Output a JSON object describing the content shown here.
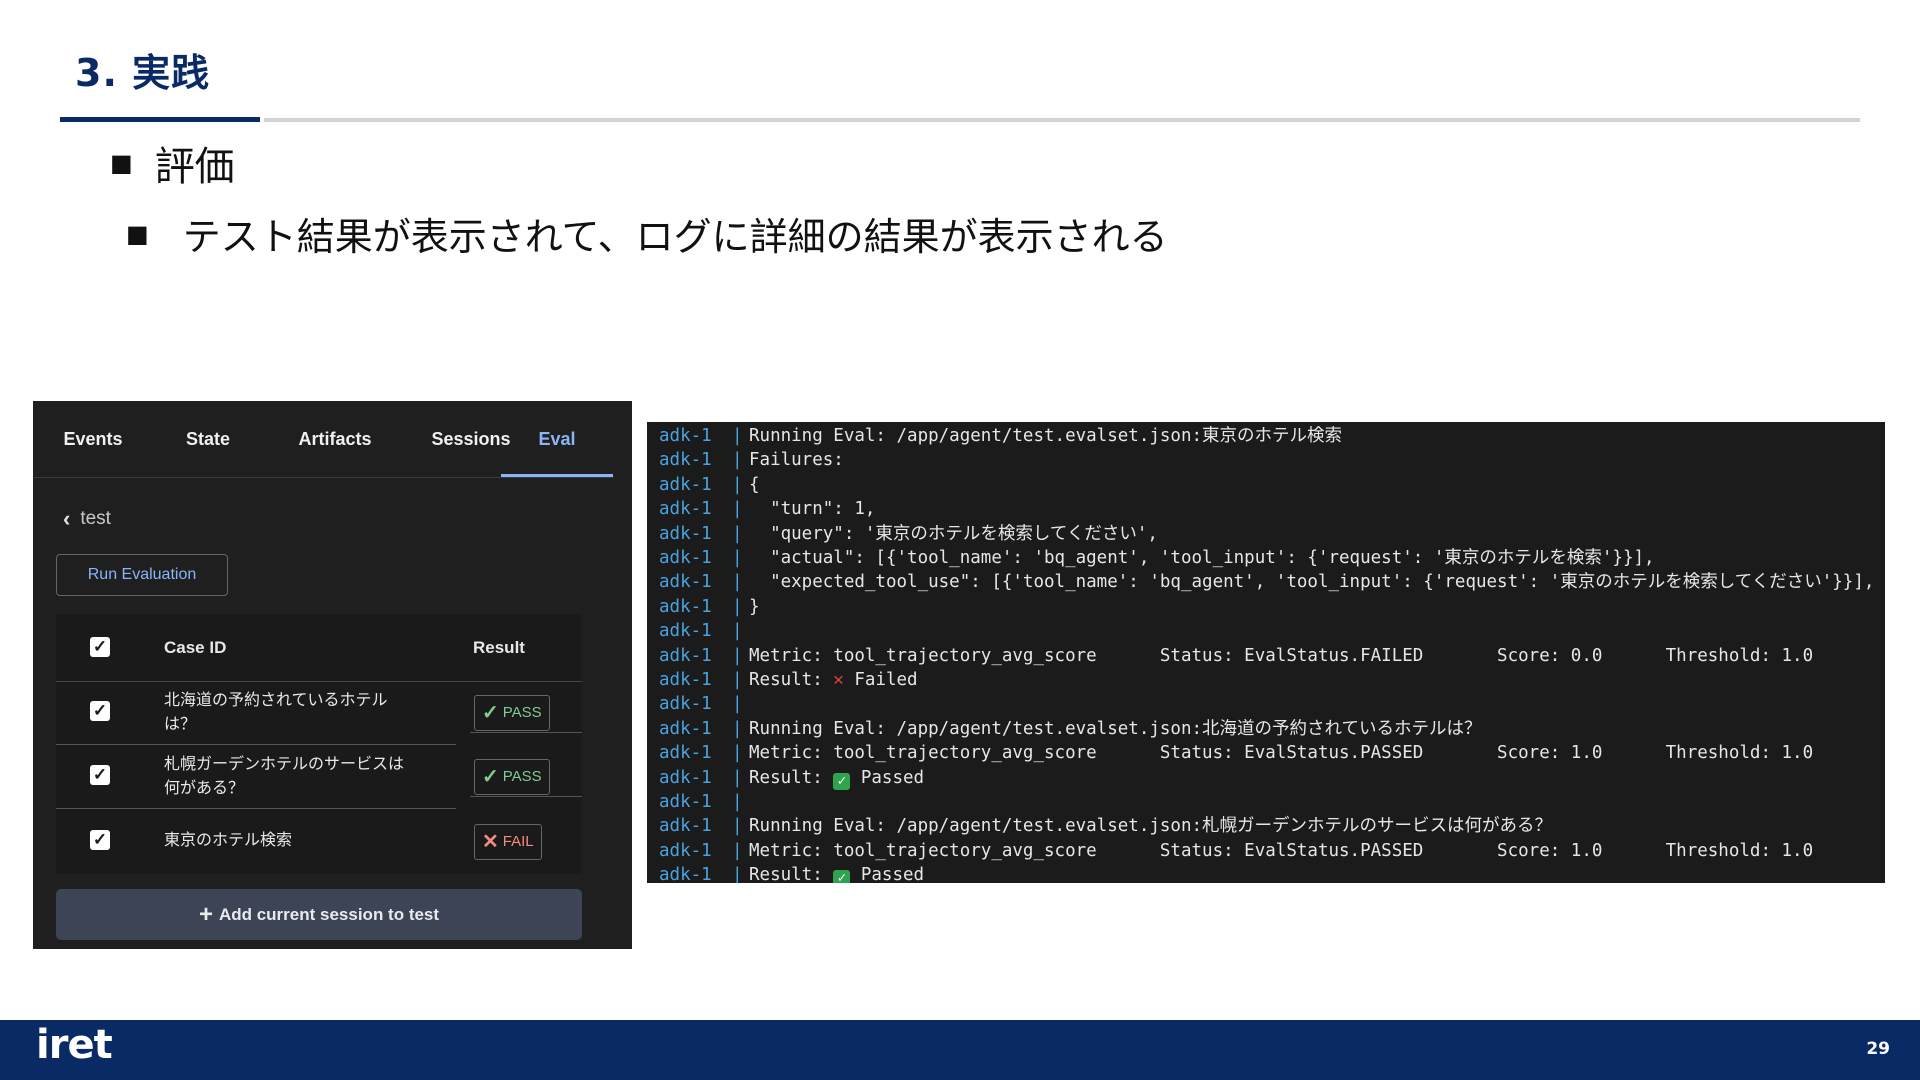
{
  "slide": {
    "title": "3. 実践",
    "bullet_mark": "■",
    "bullet1": "評価",
    "bullet2": "テスト結果が表示されて、ログに詳細の結果が表示される",
    "page_number": "29",
    "logo_text": "iret"
  },
  "eval_panel": {
    "tabs": [
      "Events",
      "State",
      "Artifacts",
      "Sessions",
      "Eval"
    ],
    "active_tab": "Eval",
    "back_label": "test",
    "run_button": "Run Evaluation",
    "table": {
      "header_case": "Case ID",
      "header_result": "Result",
      "rows": [
        {
          "case": "北海道の予約されているホテルは？",
          "result": "PASS"
        },
        {
          "case": "札幌ガーデンホテルのサービスは何がある？",
          "result": "PASS"
        },
        {
          "case": "東京のホテル検索",
          "result": "FAIL"
        }
      ]
    },
    "add_button": "Add current session to test",
    "colors": {
      "pass": "#81c995",
      "fail": "#f28b82",
      "accent": "#8ab4f8"
    }
  },
  "terminal": {
    "prefix": "adk-1",
    "lines": [
      "Running Eval: /app/agent/test.evalset.json:東京のホテル検索",
      "Failures:",
      "{",
      "  \"turn\": 1,",
      "  \"query\": '東京のホテルを検索してください',",
      "  \"actual\": [{'tool_name': 'bq_agent', 'tool_input': {'request': '東京のホテルを検索'}}],",
      "  \"expected_tool_use\": [{'tool_name': 'bq_agent', 'tool_input': {'request': '東京のホテルを検索してください'}}],",
      "}",
      "",
      "Metric: tool_trajectory_avg_score      Status: EvalStatus.FAILED       Score: 0.0      Threshold: 1.0",
      "Result: ❌ Failed",
      "",
      "Running Eval: /app/agent/test.evalset.json:北海道の予約されているホテルは？",
      "Metric: tool_trajectory_avg_score      Status: EvalStatus.PASSED       Score: 1.0      Threshold: 1.0",
      "Result: ✅ Passed",
      "",
      "Running Eval: /app/agent/test.evalset.json:札幌ガーデンホテルのサービスは何がある？",
      "Metric: tool_trajectory_avg_score      Status: EvalStatus.PASSED       Score: 1.0      Threshold: 1.0",
      "Result: ✅ Passed"
    ]
  }
}
